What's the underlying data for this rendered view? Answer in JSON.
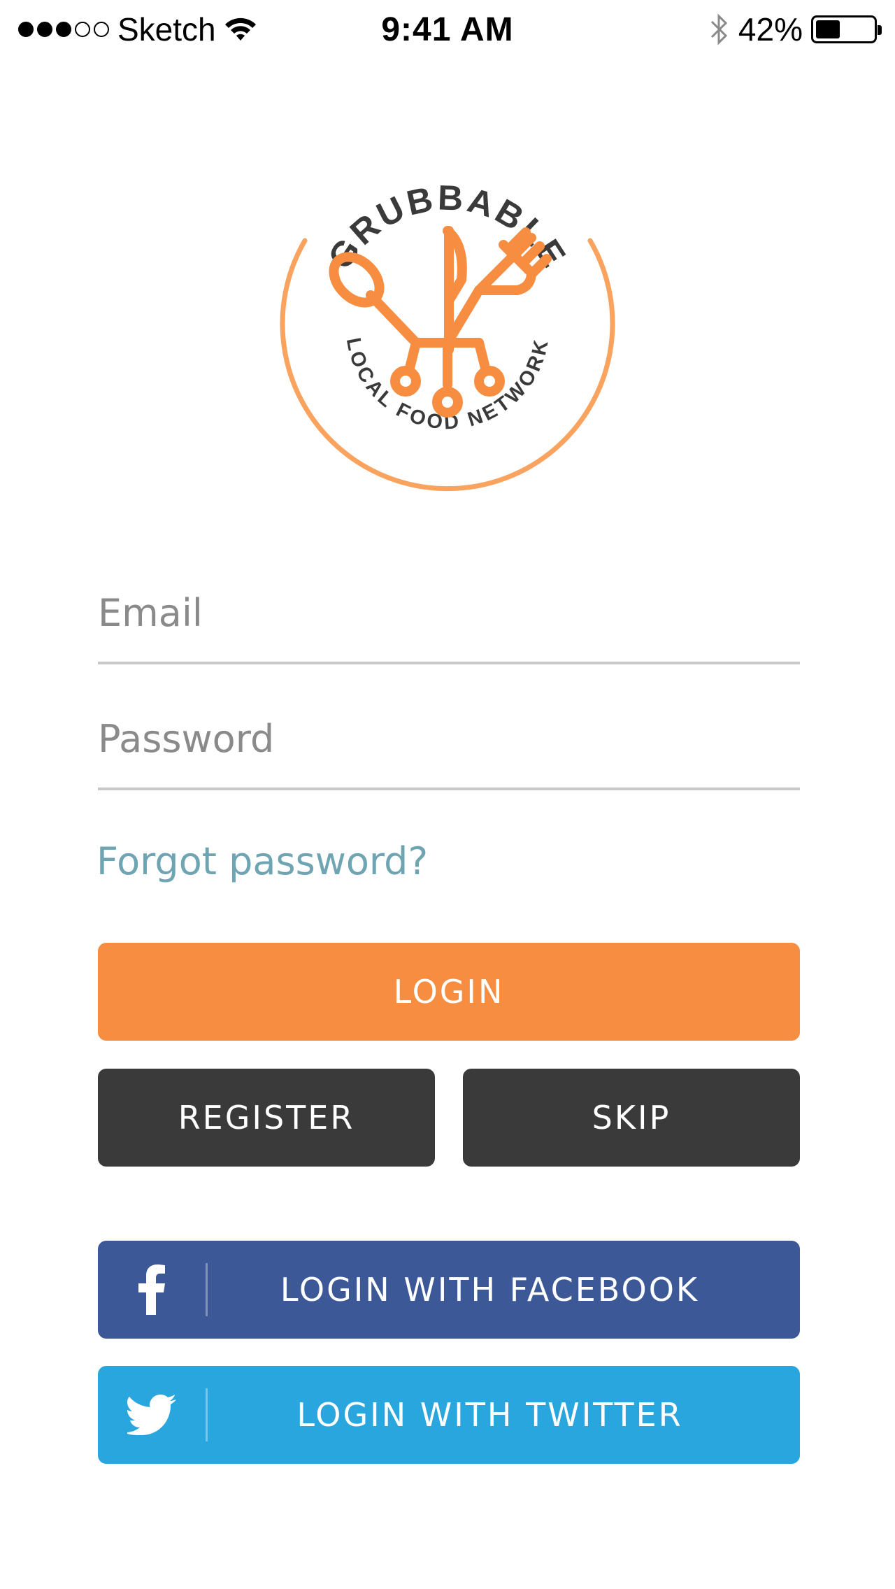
{
  "status_bar": {
    "carrier": "Sketch",
    "time": "9:41 AM",
    "battery_percent": "42%",
    "battery_level": 0.42,
    "signal_bars_filled": 3,
    "signal_bars_total": 5
  },
  "logo": {
    "brand_name": "GRUBBABLE",
    "tagline": "LOCAL FOOD NETWORK",
    "icon": "cutlery-circuit-icon",
    "accent_color": "#f68d40"
  },
  "form": {
    "email_placeholder": "Email",
    "email_value": "",
    "password_placeholder": "Password",
    "password_value": "",
    "forgot_label": "Forgot password?"
  },
  "buttons": {
    "login_label": "LOGIN",
    "register_label": "REGISTER",
    "skip_label": "SKIP",
    "facebook_label": "LOGIN WITH FACEBOOK",
    "twitter_label": "LOGIN WITH TWITTER"
  },
  "colors": {
    "login": "#f68d40",
    "secondary": "#3a3a3a",
    "facebook": "#3c5896",
    "twitter": "#2aa6df",
    "link": "#6fa4b3"
  }
}
